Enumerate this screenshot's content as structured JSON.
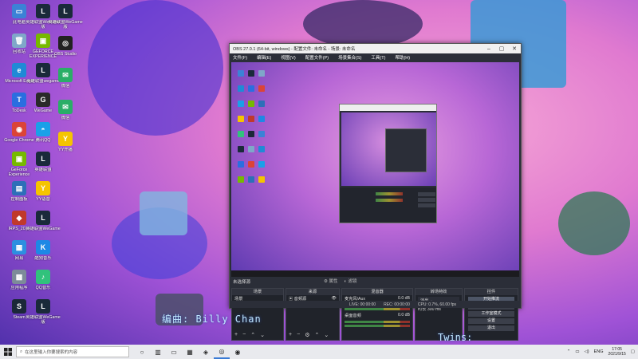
{
  "desktop": {
    "icons": [
      {
        "label": "此电脑",
        "glyph": "▭",
        "color": "#3b82d6"
      },
      {
        "label": "英雄联盟WeGame版",
        "glyph": "L",
        "color": "#1a2a3a"
      },
      {
        "label": "回收站",
        "glyph": "🗑",
        "color": "#7fa7c9"
      },
      {
        "label": "GEFORCE EXPERIENCE",
        "glyph": "▣",
        "color": "#76b900"
      },
      {
        "label": "Microsoft Edge",
        "glyph": "e",
        "color": "#1f8ad6"
      },
      {
        "label": "英雄联盟wegame",
        "glyph": "L",
        "color": "#1a2a3a"
      },
      {
        "label": "ToDesk",
        "glyph": "T",
        "color": "#2a6ee0"
      },
      {
        "label": "WeGame",
        "glyph": "G",
        "color": "#2a2a2a"
      },
      {
        "label": "Google Chrome",
        "glyph": "◉",
        "color": "#db4437"
      },
      {
        "label": "腾讯QQ",
        "glyph": "◓",
        "color": "#1aa0e8"
      },
      {
        "label": "GeForce Experience",
        "glyph": "▣",
        "color": "#76b900"
      },
      {
        "label": "英雄联盟",
        "glyph": "L",
        "color": "#1a2a3a"
      },
      {
        "label": "控制面板",
        "glyph": "▤",
        "color": "#2d6fb8"
      },
      {
        "label": "YY语音",
        "glyph": "Y",
        "color": "#f5c400"
      },
      {
        "label": "IRPS_2016",
        "glyph": "◆",
        "color": "#c0392b"
      },
      {
        "label": "英雄联盟WeGame",
        "glyph": "L",
        "color": "#1a2a3a"
      },
      {
        "label": "网易",
        "glyph": "▦",
        "color": "#2d8fe0"
      },
      {
        "label": "酷狗音乐",
        "glyph": "K",
        "color": "#1e88e5"
      },
      {
        "label": "应用程序",
        "glyph": "▩",
        "color": "#7d8b99"
      },
      {
        "label": "QQ音乐",
        "glyph": "♪",
        "color": "#31c27c"
      },
      {
        "label": "Steam",
        "glyph": "S",
        "color": "#1b2838"
      },
      {
        "label": "英雄联盟WeGame版",
        "glyph": "L",
        "color": "#1a2a3a"
      }
    ],
    "icons_col2_top": [
      {
        "label": "英雄联盟WeGame版",
        "glyph": "L",
        "color": "#1a2a3a"
      },
      {
        "label": "OBS Studio",
        "glyph": "◎",
        "color": "#222"
      },
      {
        "label": "微信",
        "glyph": "✉",
        "color": "#2aae67"
      },
      {
        "label": "微信",
        "glyph": "✉",
        "color": "#2aae67"
      },
      {
        "label": "YY开播",
        "glyph": "Y",
        "color": "#f5c400"
      }
    ]
  },
  "obs": {
    "title": "OBS 27.0.1 (64-bit, windows) - 配置文件: 未命名 - 场景: 未命名",
    "menu": [
      "文件(F)",
      "编辑(E)",
      "视图(V)",
      "配置文件(P)",
      "场景集合(S)",
      "工具(T)",
      "帮助(H)"
    ],
    "no_source": "未选择源",
    "props_button": "属性",
    "filters_button": "滤镜",
    "docks": {
      "scenes": {
        "header": "场景",
        "items": [
          "场景"
        ]
      },
      "sources": {
        "header": "来源",
        "items": [
          "音频源",
          "显示器采集"
        ]
      },
      "mixer": {
        "header": "混音器",
        "tracks": [
          {
            "name": "麦克风/Aux",
            "level": "0.0 dB"
          },
          {
            "name": "桌面音频",
            "level": "0.0 dB"
          }
        ]
      },
      "transitions": {
        "header": "转场特效",
        "type": "淡出",
        "duration_label": "时长",
        "duration": "300 ms"
      },
      "controls": {
        "header": "控件",
        "buttons": [
          "开始推流",
          "开始录制",
          "工作室模式",
          "设置",
          "退出"
        ]
      }
    },
    "status": {
      "live": "LIVE: 00:00:00",
      "rec": "REC: 00:00:00",
      "cpu": "CPU: 0.7%, 60.00 fps"
    }
  },
  "subtitles": {
    "line1": "编曲: Billy Chan",
    "line2": "Twins:"
  },
  "taskbar": {
    "search_placeholder": "在这里输入你要搜索的内容",
    "apps": [
      "○",
      "▥",
      "▭",
      "▦",
      "◈",
      "◎",
      "◉"
    ],
    "lang": "ENG",
    "time": "17:05",
    "date": "2021/9/15"
  }
}
